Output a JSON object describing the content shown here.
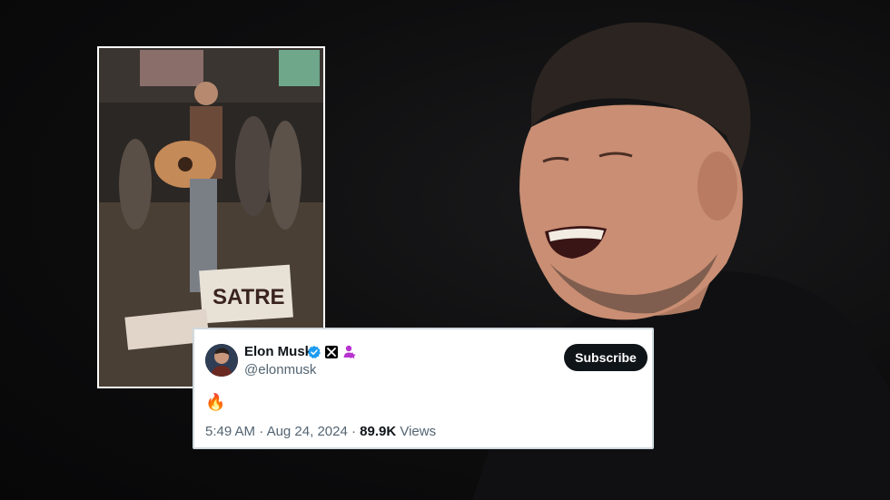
{
  "tweet": {
    "display_name": "Elon Musk",
    "handle": "@elonmusk",
    "subscribe_label": "Subscribe",
    "text": "🔥",
    "time": "5:49 AM",
    "separator": "·",
    "date": "Aug 24, 2024",
    "views_count": "89.9K",
    "views_label": "Views",
    "icons": [
      "verified-badge-icon",
      "x-logo-icon",
      "affiliate-user-icon"
    ]
  },
  "inset_photo": {
    "sign_text": "SATRE"
  },
  "colors": {
    "verified": "#1d9bf0",
    "badge_purple": "#b832d0",
    "subscribe_bg": "#0f1419",
    "muted_text": "#536471"
  }
}
